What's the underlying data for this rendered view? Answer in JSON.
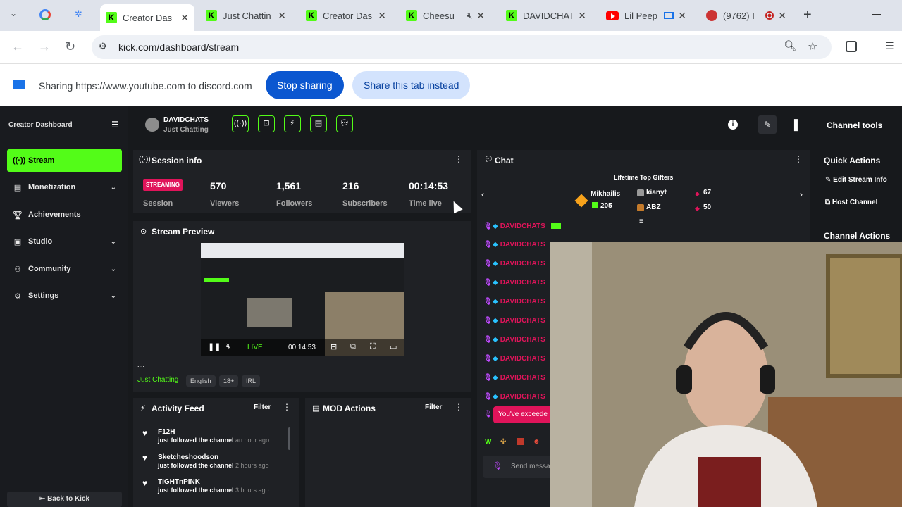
{
  "browser": {
    "tabs": [
      {
        "title": "Creator Das",
        "active": true
      },
      {
        "title": "Just Chattin"
      },
      {
        "title": "Creator Das"
      },
      {
        "title": "Cheesu"
      },
      {
        "title": "DAVIDCHAT"
      },
      {
        "title": "Lil Peep"
      },
      {
        "title": "(9762) I"
      }
    ],
    "url": "kick.com/dashboard/stream",
    "sharing_text": "Sharing https://www.youtube.com to discord.com",
    "stop_sharing": "Stop sharing",
    "share_tab": "Share this tab instead"
  },
  "sidebar": {
    "title": "Creator Dashboard",
    "items": [
      {
        "label": "Stream",
        "icon": "broadcast-icon"
      },
      {
        "label": "Monetization",
        "icon": "money-icon"
      },
      {
        "label": "Achievements",
        "icon": "trophy-icon"
      },
      {
        "label": "Studio",
        "icon": "studio-icon"
      },
      {
        "label": "Community",
        "icon": "community-icon"
      },
      {
        "label": "Settings",
        "icon": "gear-icon"
      }
    ],
    "back_label": "Back to Kick"
  },
  "header": {
    "channel_name": "DAVIDCHATS",
    "category": "Just Chatting",
    "channel_tools": "Channel tools"
  },
  "session": {
    "title": "Session info",
    "status_badge": "STREAMING",
    "session_label": "Session",
    "viewers": "570",
    "viewers_label": "Viewers",
    "followers": "1,561",
    "followers_label": "Followers",
    "subscribers": "216",
    "subscribers_label": "Subscribers",
    "time_live": "00:14:53",
    "time_live_label": "Time live"
  },
  "preview": {
    "title": "Stream Preview",
    "live": "LIVE",
    "time": "00:14:53",
    "stream_title": "....",
    "category": "Just Chatting",
    "tags": [
      "English",
      "18+",
      "IRL"
    ]
  },
  "activity": {
    "title": "Activity Feed",
    "filter": "Filter",
    "items": [
      {
        "name": "F12H",
        "action": "just followed the channel",
        "time": "an hour ago"
      },
      {
        "name": "Sketcheshoodson",
        "action": "just followed the channel",
        "time": "2 hours ago"
      },
      {
        "name": "TIGHTnPINK",
        "action": "just followed the channel",
        "time": "3 hours ago"
      }
    ]
  },
  "mod": {
    "title": "MOD Actions",
    "filter": "Filter"
  },
  "chat": {
    "title": "Chat",
    "gifters_title": "Lifetime Top Gifters",
    "gifters": [
      {
        "name": "Mikhailis",
        "count": "205"
      },
      {
        "name": "kianyt",
        "count": "67"
      },
      {
        "name": "ABZ",
        "count": "50"
      }
    ],
    "rows": [
      "DAVIDCHATS",
      "DAVIDCHATS",
      "DAVIDCHATS",
      "DAVIDCHATS",
      "DAVIDCHATS",
      "DAVIDCHATS",
      "DAVIDCHATS",
      "DAVIDCHATS",
      "DAVIDCHATS",
      "DAVIDCHATS"
    ],
    "error_text": "You've exceede",
    "send_placeholder": "Send messa"
  },
  "quick_actions": {
    "title": "Quick Actions",
    "edit": "Edit Stream Info",
    "host": "Host Channel",
    "channel_actions": "Channel Actions"
  }
}
